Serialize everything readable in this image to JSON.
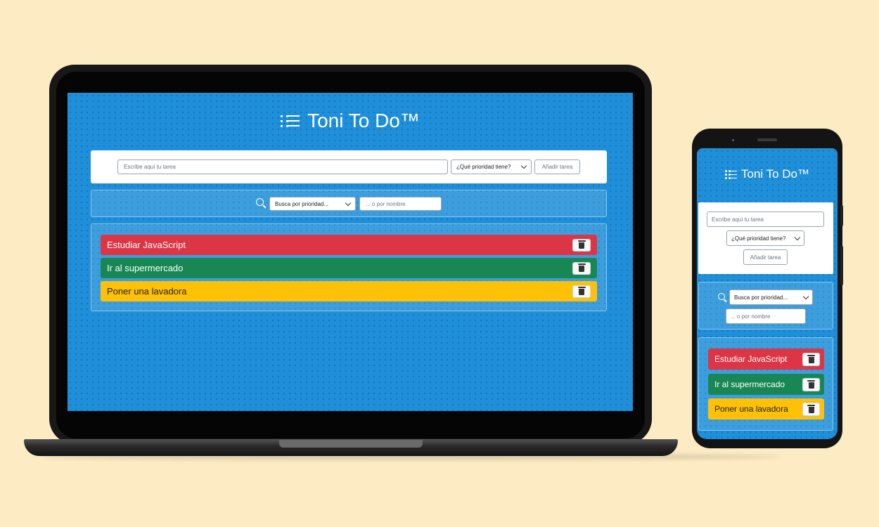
{
  "app": {
    "title": "Toni To Do™",
    "icon": "list-icon"
  },
  "task_form": {
    "task_placeholder": "Escribe aquí tu tarea",
    "priority_select": "¿Qué prioridad tiene?",
    "add_button": "Añadir tarea"
  },
  "search": {
    "icon": "search-icon",
    "priority_select": "Busca por prioridad...",
    "name_placeholder": "... o por nombre"
  },
  "tasks": [
    {
      "label": "Estudiar JavaScript",
      "color": "#dc3545"
    },
    {
      "label": "Ir al supermercado",
      "color": "#198754"
    },
    {
      "label": "Poner una lavadora",
      "color": "#ffc107"
    }
  ],
  "colors": {
    "page_background": "#fdebc4",
    "app_background": "#1e8fd8",
    "danger": "#dc3545",
    "success": "#198754",
    "warning": "#ffc107"
  }
}
